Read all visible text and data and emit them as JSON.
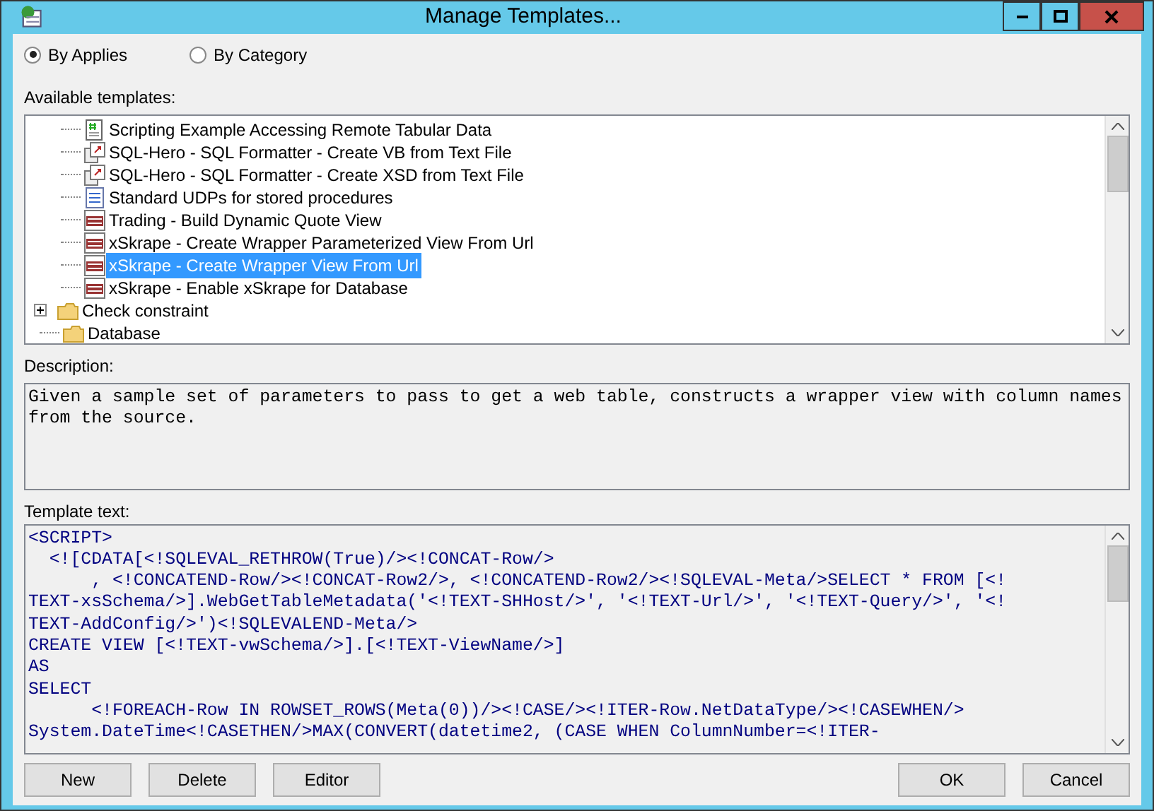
{
  "window": {
    "title": "Manage Templates..."
  },
  "view_options": [
    {
      "label": "By Applies",
      "selected": true
    },
    {
      "label": "By Category",
      "selected": false
    }
  ],
  "templates_label": "Available templates:",
  "tree": [
    {
      "children": [
        {
          "label": "Scripting Example Accessing Remote Tabular Data",
          "kind": "script",
          "selected": false
        },
        {
          "label": "SQL-Hero - SQL Formatter - Create VB from Text File",
          "kind": "link",
          "selected": false
        },
        {
          "label": "SQL-Hero - SQL Formatter - Create XSD from Text File",
          "kind": "link",
          "selected": false
        },
        {
          "label": "Standard UDPs for stored procedures",
          "kind": "doc",
          "selected": false
        },
        {
          "label": "Trading - Build Dynamic Quote View",
          "kind": "sql",
          "selected": false
        },
        {
          "label": "xSkrape - Create Wrapper Parameterized View From Url",
          "kind": "sql",
          "selected": false
        },
        {
          "label": "xSkrape - Create Wrapper View From Url",
          "kind": "sql",
          "selected": true
        },
        {
          "label": "xSkrape - Enable xSkrape for Database",
          "kind": "sql",
          "selected": false
        }
      ]
    },
    {
      "label": "Check constraint",
      "kind": "folder",
      "expanded": false
    },
    {
      "label": "Database",
      "kind": "folder"
    }
  ],
  "description_label": "Description:",
  "description": "Given a sample set of parameters to pass to get a web table, constructs a wrapper view with column names from the source.",
  "template_text_label": "Template text:",
  "template_text": [
    "<SCRIPT>",
    "  <![CDATA[<!SQLEVAL_RETHROW(True)/><!CONCAT-Row/>",
    "      , <!CONCATEND-Row/><!CONCAT-Row2/>, <!CONCATEND-Row2/><!SQLEVAL-Meta/>SELECT * FROM [<!",
    "TEXT-xsSchema/>].WebGetTableMetadata('<!TEXT-SHHost/>', '<!TEXT-Url/>', '<!TEXT-Query/>', '<!",
    "TEXT-AddConfig/>')<!SQLEVALEND-Meta/>",
    "CREATE VIEW [<!TEXT-vwSchema/>].[<!TEXT-ViewName/>]",
    "AS",
    "SELECT",
    "      <!FOREACH-Row IN ROWSET_ROWS(Meta(0))/><!CASE/><!ITER-Row.NetDataType/><!CASEWHEN/>",
    "System.DateTime<!CASETHEN/>MAX(CONVERT(datetime2, (CASE WHEN ColumnNumber=<!ITER-"
  ],
  "left_buttons": [
    "New",
    "Delete",
    "Editor"
  ],
  "right_buttons": [
    "OK",
    "Cancel"
  ]
}
